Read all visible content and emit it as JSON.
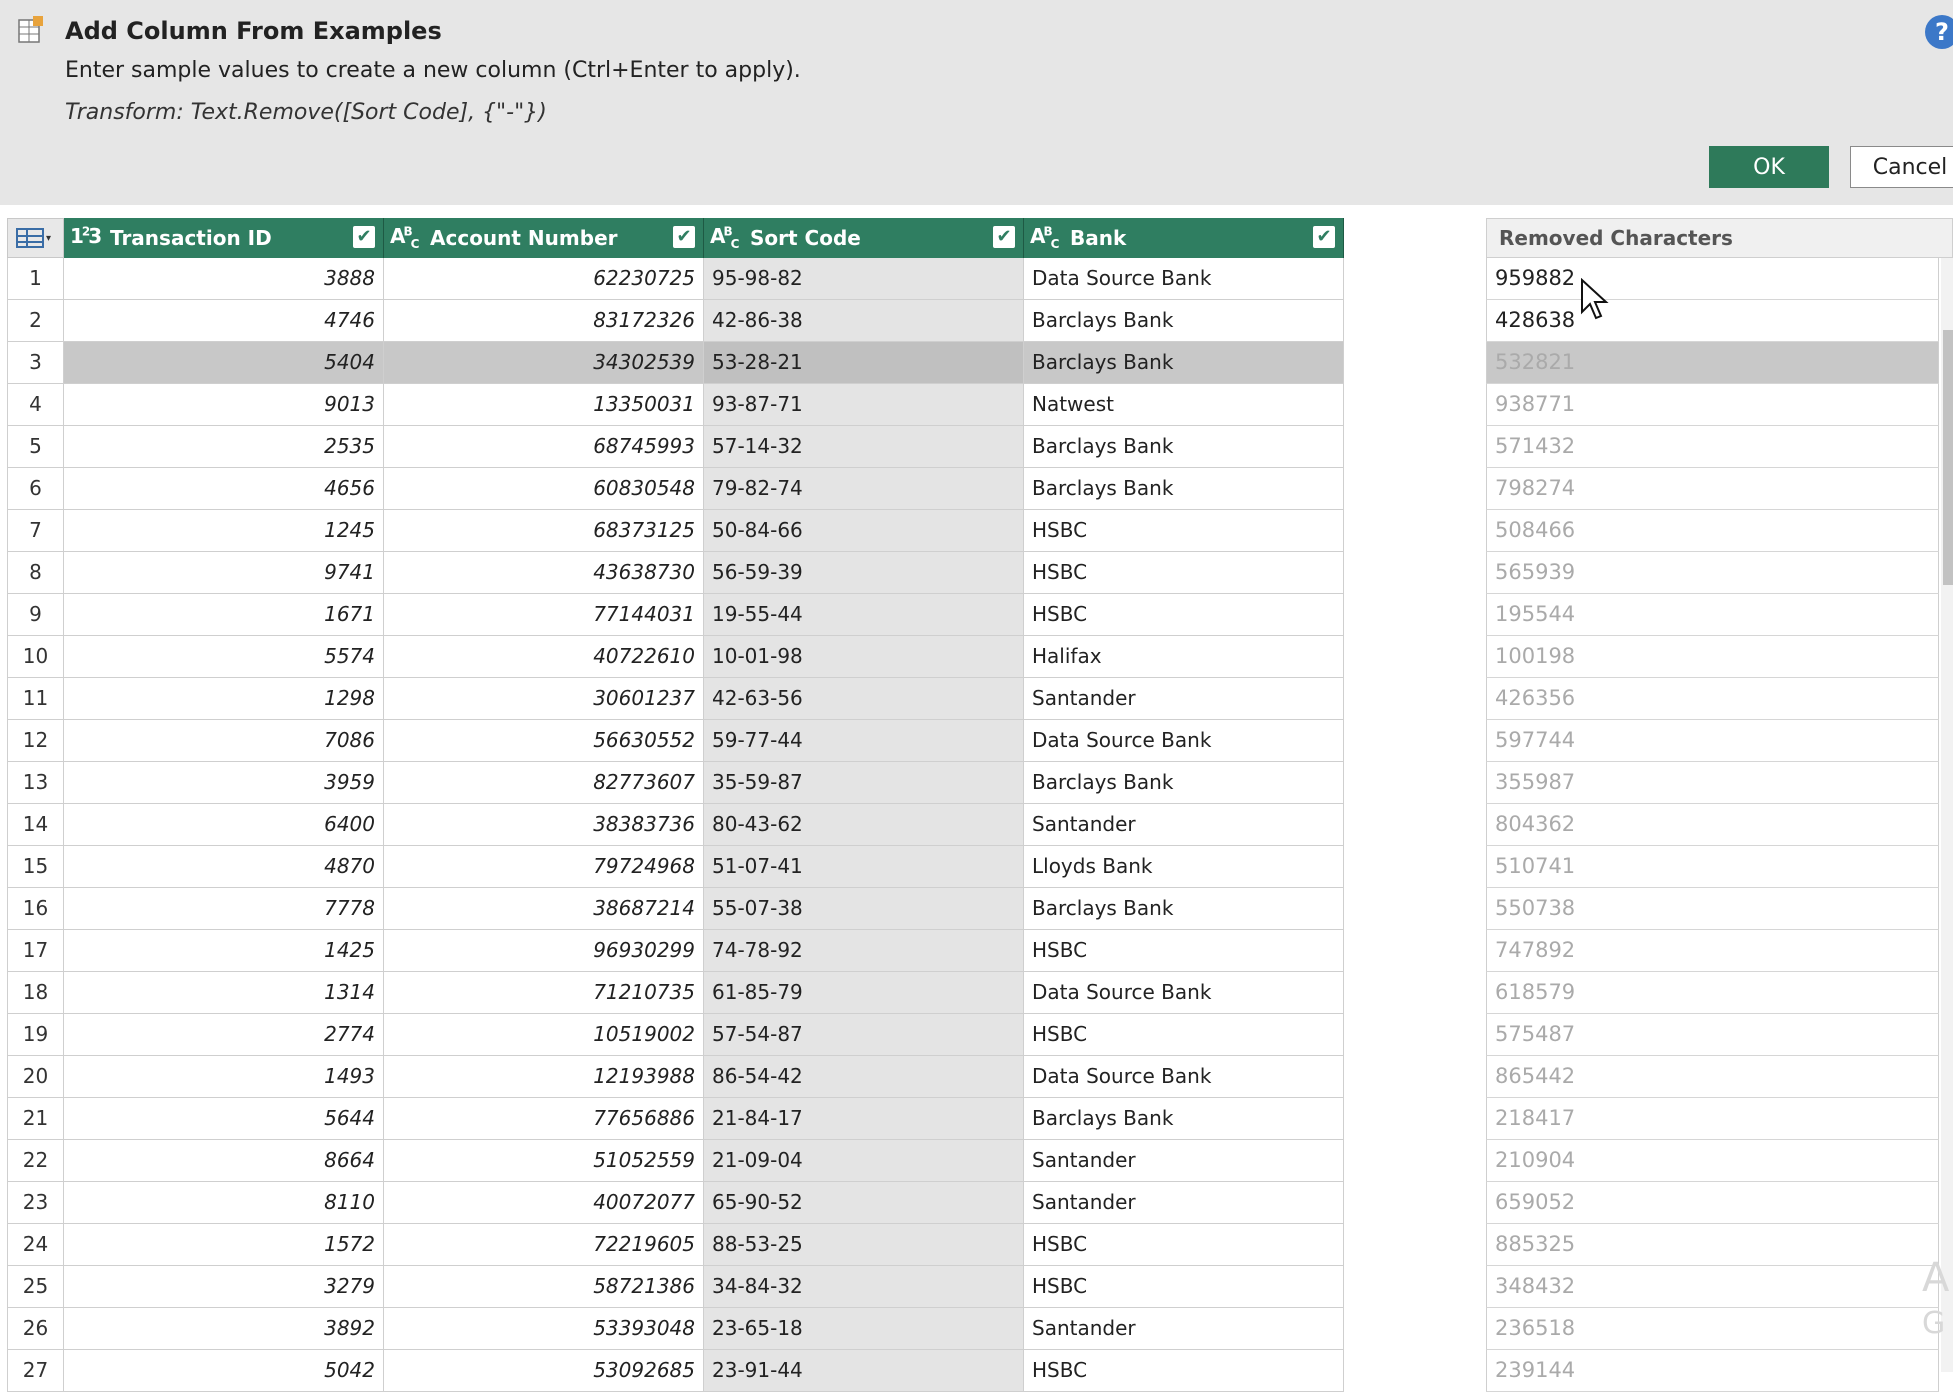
{
  "dialog": {
    "title": "Add Column From Examples",
    "description": "Enter sample values to create a new column (Ctrl+Enter to apply).",
    "transform": "Transform: Text.Remove([Sort Code], {\"-\"})",
    "ok_label": "OK",
    "cancel_label": "Cancel",
    "help_label": "?"
  },
  "columns": [
    {
      "type_icon": "123",
      "label": "Transaction ID"
    },
    {
      "type_icon": "ABC",
      "label": "Account Number"
    },
    {
      "type_icon": "ABC",
      "label": "Sort Code"
    },
    {
      "type_icon": "ABC",
      "label": "Bank"
    }
  ],
  "example_column": {
    "label": "Removed Characters"
  },
  "selected_row": 3,
  "rows": [
    {
      "n": "1",
      "tid": "3888",
      "acc": "62230725",
      "sort": "95-98-82",
      "bank": "Data Source Bank",
      "ex": "959882"
    },
    {
      "n": "2",
      "tid": "4746",
      "acc": "83172326",
      "sort": "42-86-38",
      "bank": "Barclays Bank",
      "ex": "428638"
    },
    {
      "n": "3",
      "tid": "5404",
      "acc": "34302539",
      "sort": "53-28-21",
      "bank": "Barclays Bank",
      "ex": "532821"
    },
    {
      "n": "4",
      "tid": "9013",
      "acc": "13350031",
      "sort": "93-87-71",
      "bank": "Natwest",
      "ex": "938771"
    },
    {
      "n": "5",
      "tid": "2535",
      "acc": "68745993",
      "sort": "57-14-32",
      "bank": "Barclays Bank",
      "ex": "571432"
    },
    {
      "n": "6",
      "tid": "4656",
      "acc": "60830548",
      "sort": "79-82-74",
      "bank": "Barclays Bank",
      "ex": "798274"
    },
    {
      "n": "7",
      "tid": "1245",
      "acc": "68373125",
      "sort": "50-84-66",
      "bank": "HSBC",
      "ex": "508466"
    },
    {
      "n": "8",
      "tid": "9741",
      "acc": "43638730",
      "sort": "56-59-39",
      "bank": "HSBC",
      "ex": "565939"
    },
    {
      "n": "9",
      "tid": "1671",
      "acc": "77144031",
      "sort": "19-55-44",
      "bank": "HSBC",
      "ex": "195544"
    },
    {
      "n": "10",
      "tid": "5574",
      "acc": "40722610",
      "sort": "10-01-98",
      "bank": "Halifax",
      "ex": "100198"
    },
    {
      "n": "11",
      "tid": "1298",
      "acc": "30601237",
      "sort": "42-63-56",
      "bank": "Santander",
      "ex": "426356"
    },
    {
      "n": "12",
      "tid": "7086",
      "acc": "56630552",
      "sort": "59-77-44",
      "bank": "Data Source Bank",
      "ex": "597744"
    },
    {
      "n": "13",
      "tid": "3959",
      "acc": "82773607",
      "sort": "35-59-87",
      "bank": "Barclays Bank",
      "ex": "355987"
    },
    {
      "n": "14",
      "tid": "6400",
      "acc": "38383736",
      "sort": "80-43-62",
      "bank": "Santander",
      "ex": "804362"
    },
    {
      "n": "15",
      "tid": "4870",
      "acc": "79724968",
      "sort": "51-07-41",
      "bank": "Lloyds Bank",
      "ex": "510741"
    },
    {
      "n": "16",
      "tid": "7778",
      "acc": "38687214",
      "sort": "55-07-38",
      "bank": "Barclays Bank",
      "ex": "550738"
    },
    {
      "n": "17",
      "tid": "1425",
      "acc": "96930299",
      "sort": "74-78-92",
      "bank": "HSBC",
      "ex": "747892"
    },
    {
      "n": "18",
      "tid": "1314",
      "acc": "71210735",
      "sort": "61-85-79",
      "bank": "Data Source Bank",
      "ex": "618579"
    },
    {
      "n": "19",
      "tid": "2774",
      "acc": "10519002",
      "sort": "57-54-87",
      "bank": "HSBC",
      "ex": "575487"
    },
    {
      "n": "20",
      "tid": "1493",
      "acc": "12193988",
      "sort": "86-54-42",
      "bank": "Data Source Bank",
      "ex": "865442"
    },
    {
      "n": "21",
      "tid": "5644",
      "acc": "77656886",
      "sort": "21-84-17",
      "bank": "Barclays Bank",
      "ex": "218417"
    },
    {
      "n": "22",
      "tid": "8664",
      "acc": "51052559",
      "sort": "21-09-04",
      "bank": "Santander",
      "ex": "210904"
    },
    {
      "n": "23",
      "tid": "8110",
      "acc": "40072077",
      "sort": "65-90-52",
      "bank": "Santander",
      "ex": "659052"
    },
    {
      "n": "24",
      "tid": "1572",
      "acc": "72219605",
      "sort": "88-53-25",
      "bank": "HSBC",
      "ex": "885325"
    },
    {
      "n": "25",
      "tid": "3279",
      "acc": "58721386",
      "sort": "34-84-32",
      "bank": "HSBC",
      "ex": "348432"
    },
    {
      "n": "26",
      "tid": "3892",
      "acc": "53393048",
      "sort": "23-65-18",
      "bank": "Santander",
      "ex": "236518"
    },
    {
      "n": "27",
      "tid": "5042",
      "acc": "53092685",
      "sort": "23-91-44",
      "bank": "HSBC",
      "ex": "239144"
    }
  ],
  "entered_examples": 2,
  "watermark": [
    "A",
    "G"
  ],
  "colors": {
    "header_bg": "#2f7e61",
    "ok_bg": "#2e7a5a",
    "help_bg": "#3c78c8"
  }
}
